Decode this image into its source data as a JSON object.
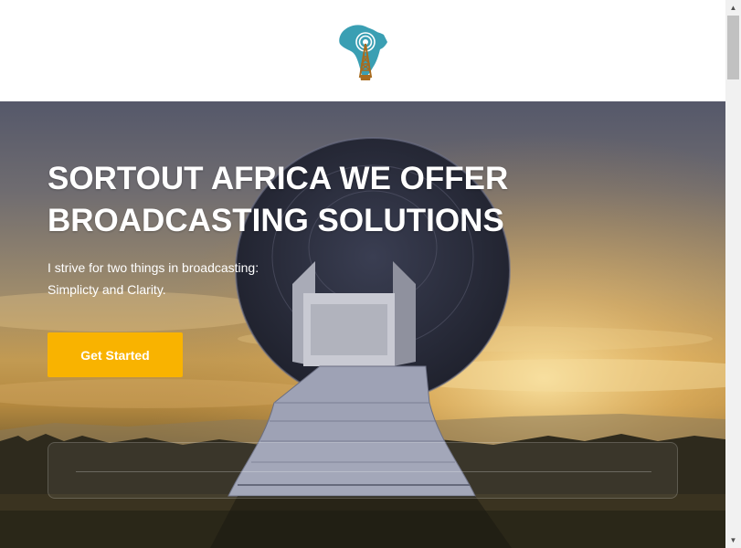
{
  "header": {
    "logo_icon": "africa-broadcast-tower-logo"
  },
  "hero": {
    "title_line1": "SORTOUT AFRICA WE OFFER",
    "title_line2": "BROADCASTING SOLUTIONS",
    "subtitle_line1": "I strive for two things in broadcasting:",
    "subtitle_line2": "Simplicty and Clarity.",
    "cta_label": "Get Started",
    "background_icon": "satellite-dish-sunset-image"
  },
  "colors": {
    "accent": "#f9b300",
    "logo_teal": "#3a9fb3",
    "logo_brown": "#a86b1e"
  },
  "scrollbar": {
    "up_icon": "▲",
    "down_icon": "▼"
  }
}
